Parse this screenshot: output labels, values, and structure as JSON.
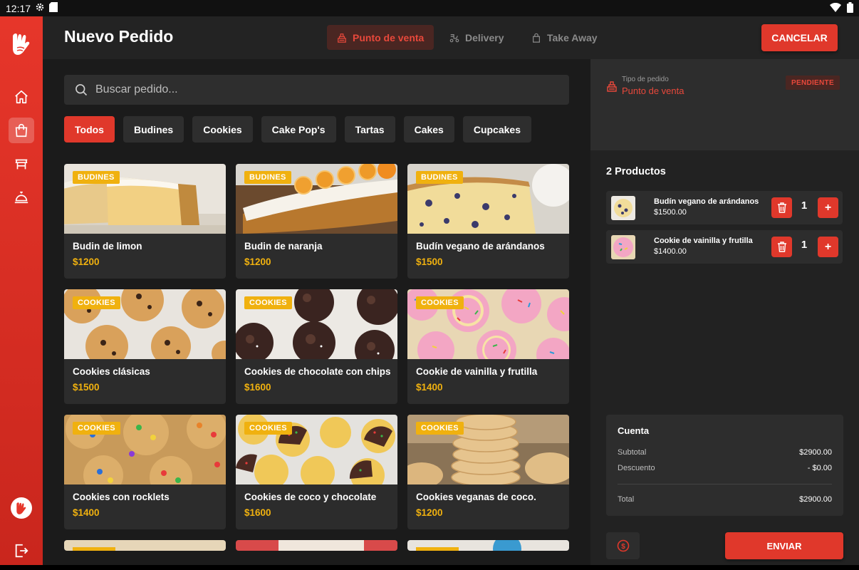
{
  "status_bar": {
    "time": "12:17"
  },
  "header": {
    "title": "Nuevo Pedido",
    "tabs": [
      {
        "label": "Punto de venta",
        "active": true,
        "icon": "register-icon"
      },
      {
        "label": "Delivery",
        "active": false,
        "icon": "scooter-icon"
      },
      {
        "label": "Take Away",
        "active": false,
        "icon": "bag-icon"
      }
    ],
    "cancel_label": "CANCELAR"
  },
  "sidebar": {
    "items": [
      {
        "name": "home-icon",
        "active": false
      },
      {
        "name": "shopping-bag-icon",
        "active": true
      },
      {
        "name": "table-icon",
        "active": false
      },
      {
        "name": "cloche-icon",
        "active": false
      }
    ]
  },
  "search": {
    "placeholder": "Buscar pedido..."
  },
  "categories": [
    "Todos",
    "Budines",
    "Cookies",
    "Cake Pop's",
    "Tartas",
    "Cakes",
    "Cupcakes"
  ],
  "active_category": "Todos",
  "products": [
    {
      "badge": "BUDINES",
      "name": "Budin de limon",
      "price": "$1200"
    },
    {
      "badge": "BUDINES",
      "name": "Budin de naranja",
      "price": "$1200"
    },
    {
      "badge": "BUDINES",
      "name": "Budín vegano de arándanos",
      "price": "$1500"
    },
    {
      "badge": "COOKIES",
      "name": "Cookies clásicas",
      "price": "$1500"
    },
    {
      "badge": "COOKIES",
      "name": "Cookies de chocolate con chips",
      "price": "$1600"
    },
    {
      "badge": "COOKIES",
      "name": "Cookie de vainilla y frutilla",
      "price": "$1400"
    },
    {
      "badge": "COOKIES",
      "name": "Cookies con rocklets",
      "price": "$1400"
    },
    {
      "badge": "COOKIES",
      "name": "Cookies de coco y chocolate",
      "price": "$1600"
    },
    {
      "badge": "COOKIES",
      "name": "Cookies veganas de coco.",
      "price": "$1200"
    }
  ],
  "order": {
    "type_label": "Tipo de pedido",
    "type_value": "Punto de venta",
    "status": "PENDIENTE",
    "products_count_label": "2 Productos",
    "items": [
      {
        "name": "Budín vegano de arándanos",
        "price": "$1500.00",
        "qty": "1"
      },
      {
        "name": "Cookie de vainilla y frutilla",
        "price": "$1400.00",
        "qty": "1"
      }
    ],
    "account": {
      "title": "Cuenta",
      "subtotal_label": "Subtotal",
      "subtotal": "$2900.00",
      "discount_label": "Descuento",
      "discount": "- $0.00",
      "total_label": "Total",
      "total": "$2900.00"
    },
    "send_label": "ENVIAR"
  },
  "colors": {
    "accent": "#e0382b",
    "price": "#f0b10f",
    "panel": "#2d2d2d"
  }
}
